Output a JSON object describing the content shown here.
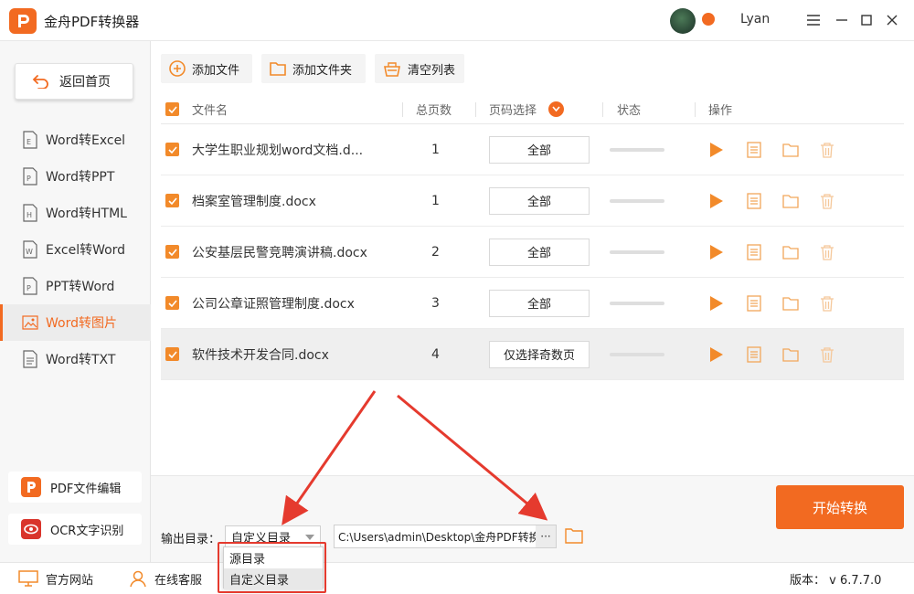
{
  "app": {
    "title": "金舟PDF转换器",
    "user": "Lyan",
    "accent": "#f26a21"
  },
  "sidebar": {
    "home_label": "返回首页",
    "items": [
      {
        "label": "Word转Excel",
        "icon": "excel-doc-icon",
        "active": false
      },
      {
        "label": "Word转PPT",
        "icon": "ppt-doc-icon",
        "active": false
      },
      {
        "label": "Word转HTML",
        "icon": "html-doc-icon",
        "active": false
      },
      {
        "label": "Excel转Word",
        "icon": "word-doc-icon",
        "active": false
      },
      {
        "label": "PPT转Word",
        "icon": "ppt-doc-icon",
        "active": false
      },
      {
        "label": "Word转图片",
        "icon": "image-icon",
        "active": true
      },
      {
        "label": "Word转TXT",
        "icon": "txt-doc-icon",
        "active": false
      }
    ],
    "tools": [
      {
        "label": "PDF文件编辑",
        "icon": "pdf-edit-icon"
      },
      {
        "label": "OCR文字识别",
        "icon": "ocr-eye-icon"
      }
    ]
  },
  "toolbar": {
    "add_file": "添加文件",
    "add_folder": "添加文件夹",
    "clear_list": "清空列表"
  },
  "table": {
    "headers": {
      "name": "文件名",
      "pages": "总页数",
      "page_select": "页码选择",
      "status": "状态",
      "actions": "操作"
    },
    "rows": [
      {
        "name": "大学生职业规划word文档.d...",
        "pages": "1",
        "page_select": "全部",
        "selected": false
      },
      {
        "name": "档案室管理制度.docx",
        "pages": "1",
        "page_select": "全部",
        "selected": false
      },
      {
        "name": "公安基层民警竞聘演讲稿.docx",
        "pages": "2",
        "page_select": "全部",
        "selected": false
      },
      {
        "name": "公司公章证照管理制度.docx",
        "pages": "3",
        "page_select": "全部",
        "selected": false
      },
      {
        "name": "软件技术开发合同.docx",
        "pages": "4",
        "page_select": "仅选择奇数页",
        "selected": true
      }
    ]
  },
  "output": {
    "label": "输出目录：",
    "selected": "自定义目录",
    "options": [
      "源目录",
      "自定义目录"
    ],
    "path": "C:\\Users\\admin\\Desktop\\金舟PDF转换",
    "browse": "···"
  },
  "start_label": "开始转换",
  "footer": {
    "website": "官方网站",
    "support": "在线客服",
    "version": "版本： v 6.7.7.0"
  }
}
